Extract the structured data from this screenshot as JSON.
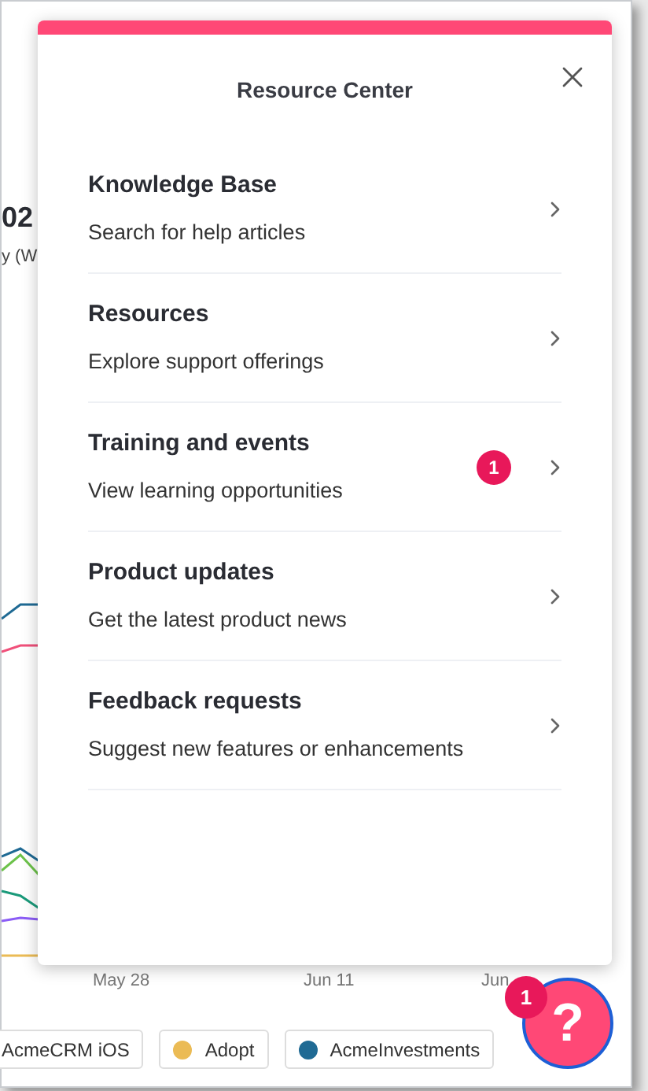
{
  "background": {
    "metric_value": "02",
    "metric_caption": "y (W",
    "x_axis_labels": [
      "May 28",
      "Jun 11",
      "Jun"
    ],
    "legend": [
      {
        "label": "AcmeCRM iOS"
      },
      {
        "label": "Adopt",
        "color": "#ebbb55"
      },
      {
        "label": "AcmeInvestments",
        "color": "#1f6a94"
      }
    ]
  },
  "resource_center": {
    "title": "Resource Center",
    "items": [
      {
        "title": "Knowledge Base",
        "subtitle": "Search for help articles"
      },
      {
        "title": "Resources",
        "subtitle": "Explore support offerings"
      },
      {
        "title": "Training and events",
        "subtitle": "View learning opportunities",
        "badge": "1"
      },
      {
        "title": "Product updates",
        "subtitle": "Get the latest product news"
      },
      {
        "title": "Feedback requests",
        "subtitle": "Suggest new features or enhancements"
      }
    ]
  },
  "help_button": {
    "label": "?",
    "badge": "1"
  }
}
